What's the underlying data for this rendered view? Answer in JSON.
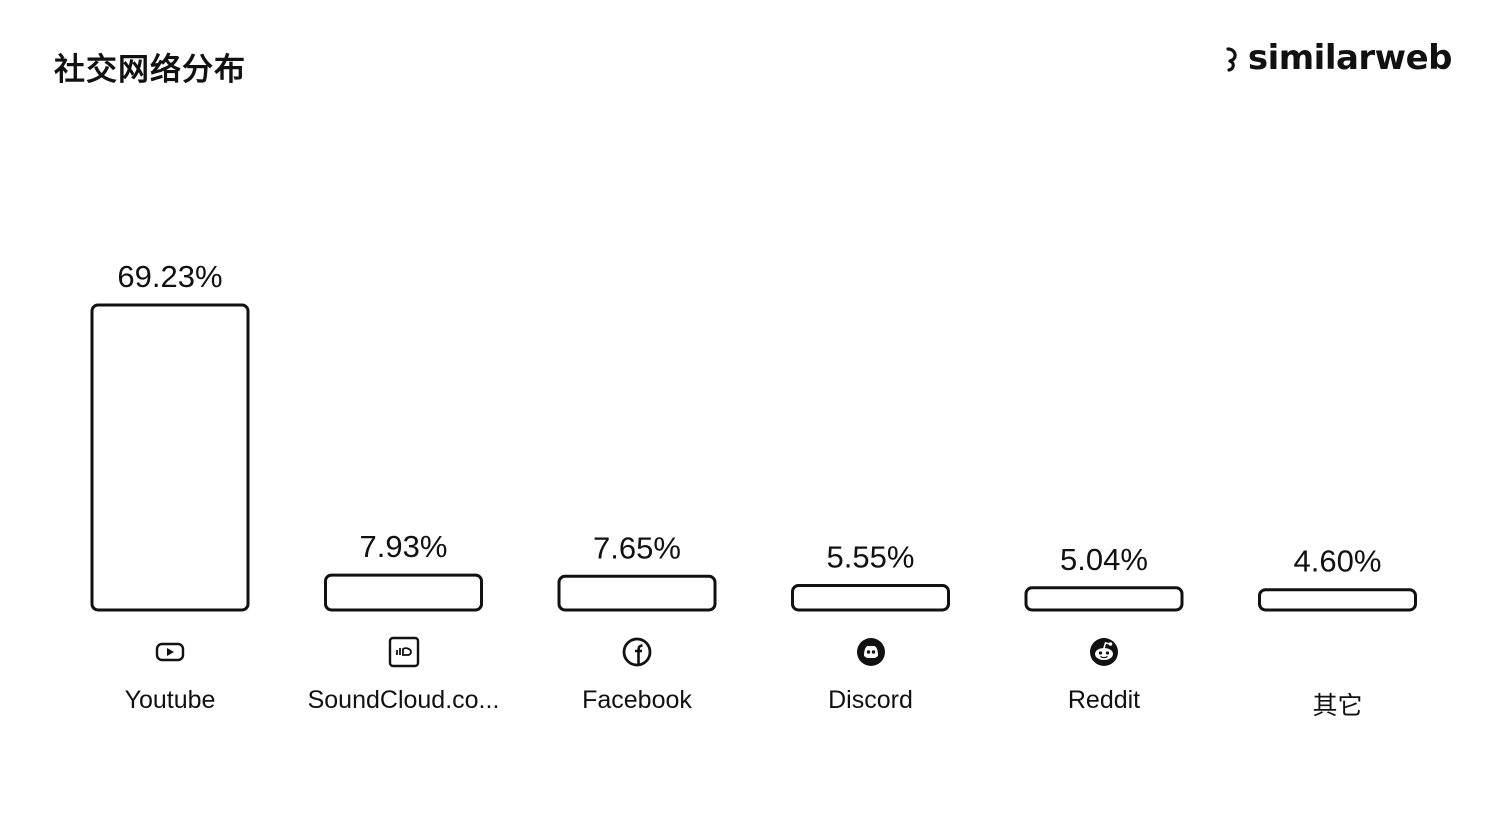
{
  "header": {
    "title": "社交网络分布",
    "brand": "similarweb",
    "brand_icon": "similarweb-logo-icon"
  },
  "chart_data": {
    "type": "bar",
    "title": "社交网络分布",
    "xlabel": "",
    "ylabel": "",
    "ylim": [
      0,
      69.23
    ],
    "grid": false,
    "categories": [
      "Youtube",
      "SoundCloud.co...",
      "Facebook",
      "Discord",
      "Reddit",
      "其它"
    ],
    "values": [
      69.23,
      7.93,
      7.65,
      5.55,
      5.04,
      4.6
    ],
    "value_labels": [
      "69.23%",
      "7.93%",
      "7.65%",
      "5.55%",
      "5.04%",
      "4.60%"
    ],
    "icons": [
      "youtube-icon",
      "soundcloud-icon",
      "facebook-icon",
      "discord-icon",
      "reddit-icon",
      ""
    ],
    "bar_color": "#ffffff",
    "bar_outline": "#111111"
  }
}
